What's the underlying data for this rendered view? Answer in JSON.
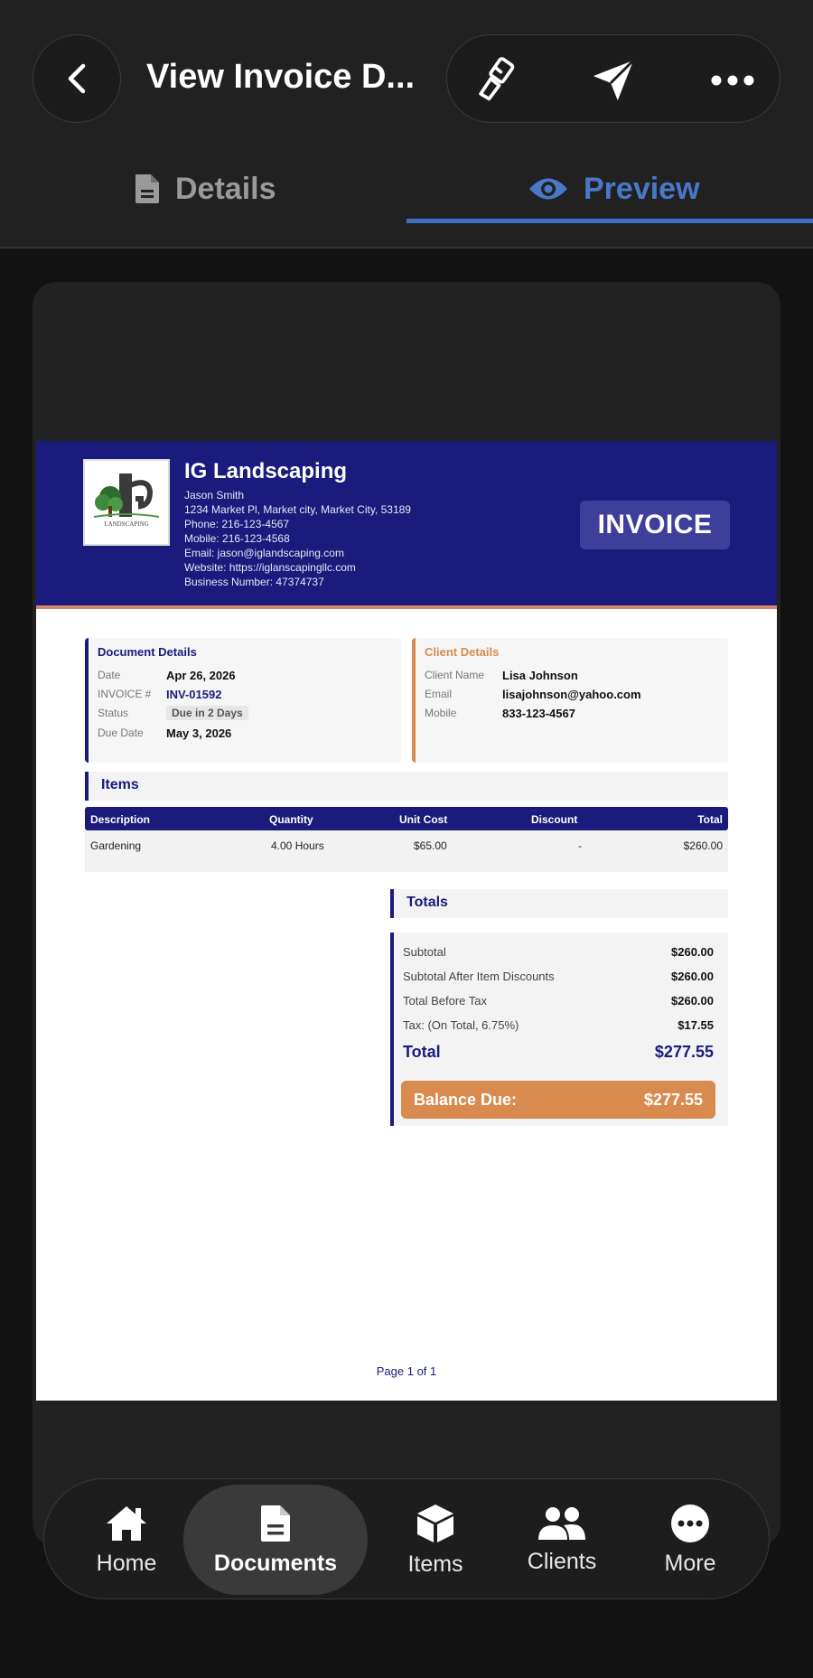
{
  "header": {
    "title": "View Invoice D...",
    "tabs": [
      {
        "label": "Details",
        "icon": "document-icon",
        "active": false
      },
      {
        "label": "Preview",
        "icon": "eye-icon",
        "active": true
      }
    ],
    "accent_color": "#3f6ec6"
  },
  "invoice": {
    "company": {
      "name": "IG Landscaping",
      "contact": "Jason Smith",
      "address": "1234 Market Pl, Market city, Market City, 53189",
      "phone": "Phone: 216-123-4567",
      "mobile": "Mobile: 216-123-4568",
      "email": "Email: jason@iglandscaping.com",
      "website": "Website: https://iglanscapingllc.com",
      "business_number": "Business Number: 47374737",
      "logo_text": "LANDSCAPING"
    },
    "badge": "INVOICE",
    "document_details": {
      "title": "Document Details",
      "date_label": "Date",
      "date": "Apr 26, 2026",
      "invoice_label": "INVOICE #",
      "invoice_number": "INV-01592",
      "status_label": "Status",
      "status": "Due in 2 Days",
      "due_label": "Due Date",
      "due_date": "May 3, 2026"
    },
    "client_details": {
      "title": "Client Details",
      "name_label": "Client Name",
      "name": "Lisa Johnson",
      "email_label": "Email",
      "email": "lisajohnson@yahoo.com",
      "mobile_label": "Mobile",
      "mobile": "833-123-4567"
    },
    "items": {
      "title": "Items",
      "columns": [
        "Description",
        "Quantity",
        "Unit Cost",
        "Discount",
        "Total"
      ],
      "rows": [
        [
          "Gardening",
          "4.00 Hours",
          "$65.00",
          "-",
          "$260.00"
        ]
      ]
    },
    "totals": {
      "title": "Totals",
      "subtotal_label": "Subtotal",
      "subtotal": "$260.00",
      "after_disc_label": "Subtotal After Item Discounts",
      "after_disc": "$260.00",
      "before_tax_label": "Total Before Tax",
      "before_tax": "$260.00",
      "tax_label": "Tax: (On Total, 6.75%)",
      "tax": "$17.55",
      "total_label": "Total",
      "total": "$277.55",
      "balance_label": "Balance Due:",
      "balance": "$277.55"
    },
    "page": "Page 1 of 1",
    "colors": {
      "primary": "#1a1b7c",
      "accent": "#d98a4e"
    }
  },
  "bottom_nav": {
    "items": [
      {
        "label": "Home",
        "icon": "home-icon"
      },
      {
        "label": "Documents",
        "icon": "document-icon",
        "active": true
      },
      {
        "label": "Items",
        "icon": "box-icon"
      },
      {
        "label": "Clients",
        "icon": "users-icon"
      },
      {
        "label": "More",
        "icon": "more-icon"
      }
    ]
  }
}
